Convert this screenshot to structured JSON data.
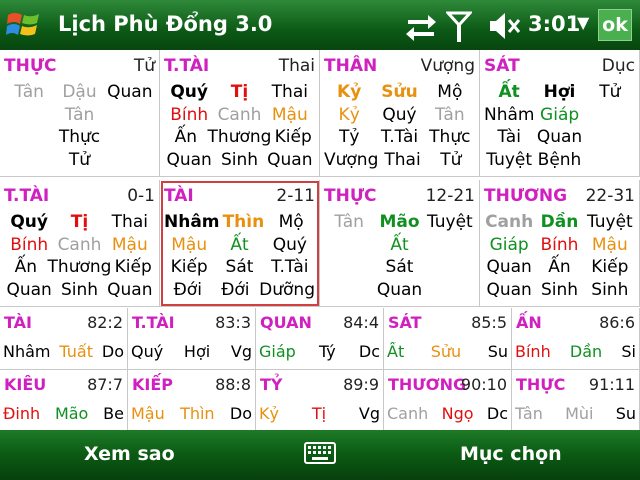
{
  "titlebar": {
    "title": "Lịch Phù Đổng 3.0",
    "time": "3:01",
    "ok_label": "ok"
  },
  "colors": {
    "accent_green": "#0c5a16",
    "magenta": "#d020c0",
    "red": "#e01010",
    "orange": "#e89010",
    "green": "#109020",
    "gray": "#a0a0a0"
  },
  "grid": [
    {
      "head": "THỰC",
      "num": "Tử",
      "rows": [
        [
          "Tân",
          "Dậu",
          "Quan"
        ],
        [
          "",
          "Tân",
          ""
        ],
        [
          "",
          "Thực",
          ""
        ],
        [
          "",
          "Tử",
          ""
        ]
      ]
    },
    {
      "head": "T.TÀI",
      "num": "Thai",
      "rows": [
        [
          "Quý",
          "Tị",
          "Thai"
        ],
        [
          "Bính",
          "Canh",
          "Mậu"
        ],
        [
          "Ấn",
          "Thương",
          "Kiếp"
        ],
        [
          "Quan",
          "Sinh",
          "Quan"
        ]
      ]
    },
    {
      "head": "THÂN",
      "num": "Vượng",
      "rows": [
        [
          "Kỷ",
          "Sửu",
          "Mộ"
        ],
        [
          "Kỷ",
          "Quý",
          "Tân"
        ],
        [
          "Tỷ",
          "T.Tài",
          "Thực"
        ],
        [
          "Vượng",
          "Thai",
          "Tử"
        ]
      ]
    },
    {
      "head": "SÁT",
      "num": "Dục",
      "rows": [
        [
          "Ất",
          "Hợi",
          "Tử"
        ],
        [
          "Nhâm",
          "Giáp",
          ""
        ],
        [
          "Tài",
          "Quan",
          ""
        ],
        [
          "Tuyệt",
          "Bệnh",
          ""
        ]
      ]
    },
    {
      "head": "T.TÀI",
      "num": "0-1",
      "rows": [
        [
          "Quý",
          "Tị",
          "Thai"
        ],
        [
          "Bính",
          "Canh",
          "Mậu"
        ],
        [
          "Ấn",
          "Thương",
          "Kiếp"
        ],
        [
          "Quan",
          "Sinh",
          "Quan"
        ]
      ]
    },
    {
      "head": "TÀI",
      "num": "2-11",
      "rows": [
        [
          "Nhâm",
          "Thìn",
          "Mộ"
        ],
        [
          "Mậu",
          "Ất",
          "Quý"
        ],
        [
          "Kiếp",
          "Sát",
          "T.Tài"
        ],
        [
          "Đới",
          "Đới",
          "Dưỡng"
        ]
      ]
    },
    {
      "head": "THỰC",
      "num": "12-21",
      "rows": [
        [
          "Tân",
          "Mão",
          "Tuyệt"
        ],
        [
          "",
          "Ất",
          ""
        ],
        [
          "",
          "Sát",
          ""
        ],
        [
          "",
          "Quan",
          ""
        ]
      ]
    },
    {
      "head": "THƯƠNG",
      "num": "22-31",
      "rows": [
        [
          "Canh",
          "Dần",
          "Tuyệt"
        ],
        [
          "Giáp",
          "Bính",
          "Mậu"
        ],
        [
          "Quan",
          "Ấn",
          "Kiếp"
        ],
        [
          "Quan",
          "Sinh",
          "Sinh"
        ]
      ]
    }
  ],
  "bottom": [
    {
      "head": "TÀI",
      "num": "82:2",
      "vals": [
        "Nhâm",
        "Tuất",
        "Do"
      ]
    },
    {
      "head": "T.TÀI",
      "num": "83:3",
      "vals": [
        "Quý",
        "Hợi",
        "Vg"
      ]
    },
    {
      "head": "QUAN",
      "num": "84:4",
      "vals": [
        "Giáp",
        "Tý",
        "Dc"
      ]
    },
    {
      "head": "SÁT",
      "num": "85:5",
      "vals": [
        "Ất",
        "Sửu",
        "Su"
      ]
    },
    {
      "head": "ẤN",
      "num": "86:6",
      "vals": [
        "Bính",
        "Dần",
        "Si"
      ]
    },
    {
      "head": "KIÊU",
      "num": "87:7",
      "vals": [
        "Đinh",
        "Mão",
        "Be"
      ]
    },
    {
      "head": "KIẾP",
      "num": "88:8",
      "vals": [
        "Mậu",
        "Thìn",
        "Do"
      ]
    },
    {
      "head": "TỶ",
      "num": "89:9",
      "vals": [
        "Kỷ",
        "Tị",
        "Vg"
      ]
    },
    {
      "head": "THƯƠNG",
      "num": "90:10",
      "vals": [
        "Canh",
        "Ngọ",
        "Dc"
      ]
    },
    {
      "head": "THỰC",
      "num": "91:11",
      "vals": [
        "Tân",
        "Mùi",
        "Su"
      ]
    }
  ],
  "menubar": {
    "left": "Xem sao",
    "right": "Mục chọn"
  }
}
